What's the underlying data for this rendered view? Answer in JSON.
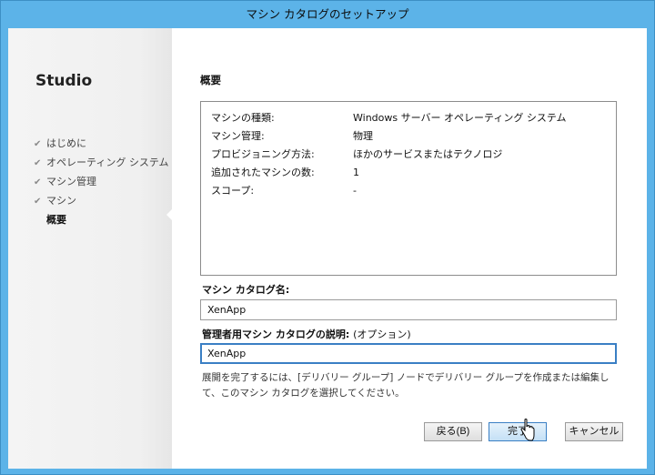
{
  "window": {
    "title": "マシン カタログのセットアップ"
  },
  "sidebar": {
    "brand": "Studio",
    "steps": [
      {
        "label": "はじめに",
        "done": true
      },
      {
        "label": "オペレーティング システム",
        "done": true
      },
      {
        "label": "マシン管理",
        "done": true
      },
      {
        "label": "マシン",
        "done": true
      },
      {
        "label": "概要",
        "done": false,
        "current": true
      }
    ],
    "check_glyph": "✔"
  },
  "main": {
    "heading": "概要",
    "summary": [
      {
        "key": "マシンの種類:",
        "value": "Windows サーバー オペレーティング システム"
      },
      {
        "key": "マシン管理:",
        "value": "物理"
      },
      {
        "key": "プロビジョニング方法:",
        "value": "ほかのサービスまたはテクノロジ"
      },
      {
        "key": "追加されたマシンの数:",
        "value": "1"
      },
      {
        "key": "スコープ:",
        "value": "-"
      }
    ],
    "catalog_name_label": "マシン カタログ名:",
    "catalog_name_value": "XenApp",
    "description_label": "管理者用マシン カタログの説明:",
    "description_optional": "(オプション)",
    "description_value": "XenApp",
    "hint": "展開を完了するには、[デリバリー グループ] ノードでデリバリー グループを作成または編集して、このマシン カタログを選択してください。"
  },
  "buttons": {
    "back": "戻る(B)",
    "finish": "完了",
    "cancel": "キャンセル"
  },
  "colors": {
    "accent": "#3a7fc4",
    "titlebar": "#5cb3e8"
  }
}
